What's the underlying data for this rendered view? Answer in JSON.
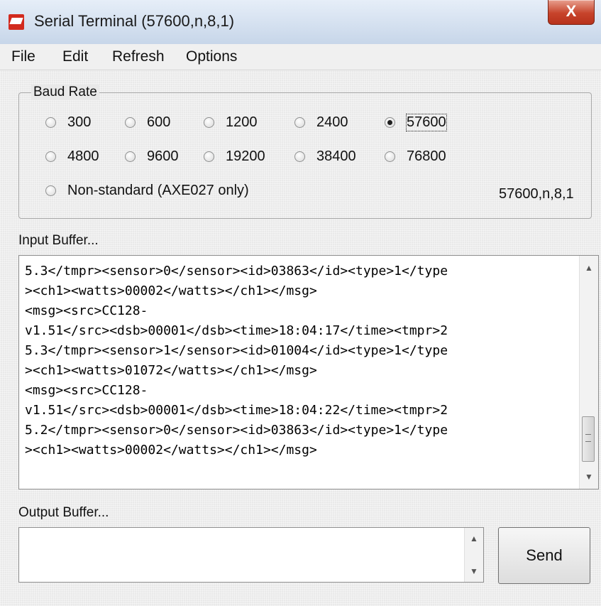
{
  "window": {
    "title": "Serial Terminal (57600,n,8,1)",
    "close_glyph": "X"
  },
  "menu": {
    "items": [
      "File",
      "Edit",
      "Refresh",
      "Options"
    ]
  },
  "baud": {
    "legend": "Baud Rate",
    "options": [
      "300",
      "600",
      "1200",
      "2400",
      "57600",
      "4800",
      "9600",
      "19200",
      "38400",
      "76800",
      "Non-standard (AXE027 only)"
    ],
    "selected": "57600",
    "status": "57600,n,8,1"
  },
  "input_buffer": {
    "label": "Input Buffer...",
    "lines": [
      "5.3</tmpr><sensor>0</sensor><id>03863</id><type>1</type",
      "><ch1><watts>00002</watts></ch1></msg>",
      "<msg><src>CC128-",
      "v1.51</src><dsb>00001</dsb><time>18:04:17</time><tmpr>2",
      "5.3</tmpr><sensor>1</sensor><id>01004</id><type>1</type",
      "><ch1><watts>01072</watts></ch1></msg>",
      "<msg><src>CC128-",
      "v1.51</src><dsb>00001</dsb><time>18:04:22</time><tmpr>2",
      "5.2</tmpr><sensor>0</sensor><id>03863</id><type>1</type",
      "><ch1><watts>00002</watts></ch1></msg>"
    ]
  },
  "output_buffer": {
    "label": "Output Buffer...",
    "value": ""
  },
  "send_button": {
    "label": "Send"
  },
  "icons": {
    "app": "serial-terminal-app-icon",
    "close": "close-icon",
    "scroll_up": "scroll-up-arrow-icon",
    "scroll_down": "scroll-down-arrow-icon"
  }
}
